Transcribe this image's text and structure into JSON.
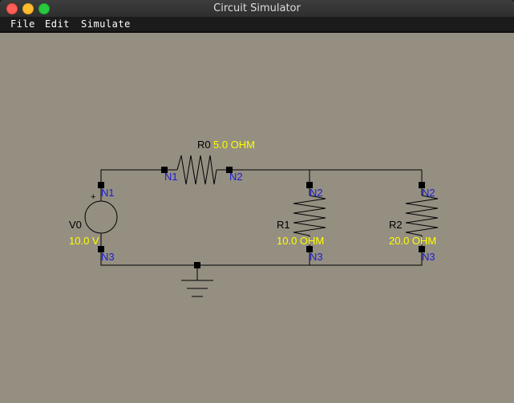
{
  "window": {
    "title": "Circuit Simulator"
  },
  "menu": {
    "file": "File",
    "edit": "Edit",
    "simulate": "Simulate"
  },
  "circuit": {
    "components": {
      "r0": {
        "name": "R0",
        "value": "5.0 OHM"
      },
      "r1": {
        "name": "R1",
        "value": "10.0 OHM"
      },
      "r2": {
        "name": "R2",
        "value": "20.0 OHM"
      },
      "v0": {
        "name": "V0",
        "value": "10.0 V",
        "polarity": "+"
      }
    },
    "nodes": {
      "n1": "N1",
      "n2": "N2",
      "n3": "N3"
    }
  },
  "colors": {
    "background": "#958f82",
    "wire": "#000000",
    "node_label": "#1d1dd0",
    "value_label": "#ffff00",
    "name_label": "#000000"
  }
}
